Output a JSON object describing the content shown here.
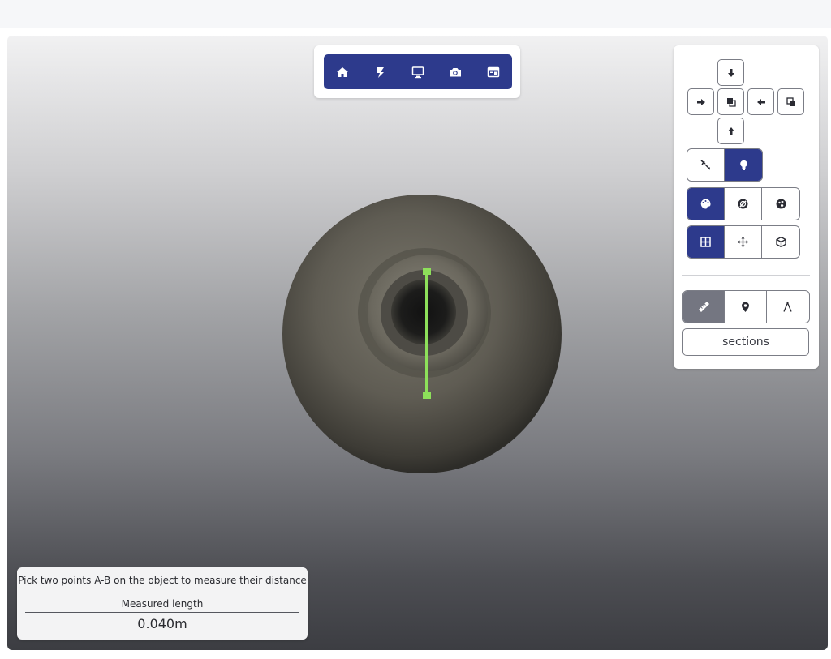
{
  "toolbar": {
    "buttons": [
      {
        "name": "home-icon"
      },
      {
        "name": "light-icon"
      },
      {
        "name": "fullscreen-icon"
      },
      {
        "name": "camera-icon"
      },
      {
        "name": "panel-icon"
      }
    ]
  },
  "view_controls": {
    "icons": [
      "arrow-down-icon",
      "arrow-right-icon",
      "view-front-icon",
      "arrow-left-icon",
      "view-back-icon",
      "arrow-up-icon"
    ]
  },
  "light_controls": {
    "items": [
      {
        "icon": "light-direction-icon",
        "active": false
      },
      {
        "icon": "bulb-icon",
        "active": true
      }
    ]
  },
  "color_controls": {
    "items": [
      {
        "icon": "palette-icon",
        "active": true
      },
      {
        "icon": "solid-color-icon",
        "active": false
      },
      {
        "icon": "texture-color-icon",
        "active": false
      }
    ]
  },
  "projection_controls": {
    "items": [
      {
        "icon": "grid-icon",
        "active": true
      },
      {
        "icon": "move-icon",
        "active": false
      },
      {
        "icon": "cube-icon",
        "active": false
      }
    ]
  },
  "tools": {
    "items": [
      {
        "icon": "ruler-icon",
        "active": true
      },
      {
        "icon": "pin-icon",
        "active": false
      },
      {
        "icon": "angle-icon",
        "active": false
      }
    ],
    "sections_label": "sections"
  },
  "measure_panel": {
    "instruction": "Pick two points A-B on the object to measure their distance",
    "label": "Measured length",
    "value": "0.040m"
  },
  "colors": {
    "accent": "#2d3a8c",
    "measure_line": "#8de05a",
    "active_tool": "#747681"
  }
}
